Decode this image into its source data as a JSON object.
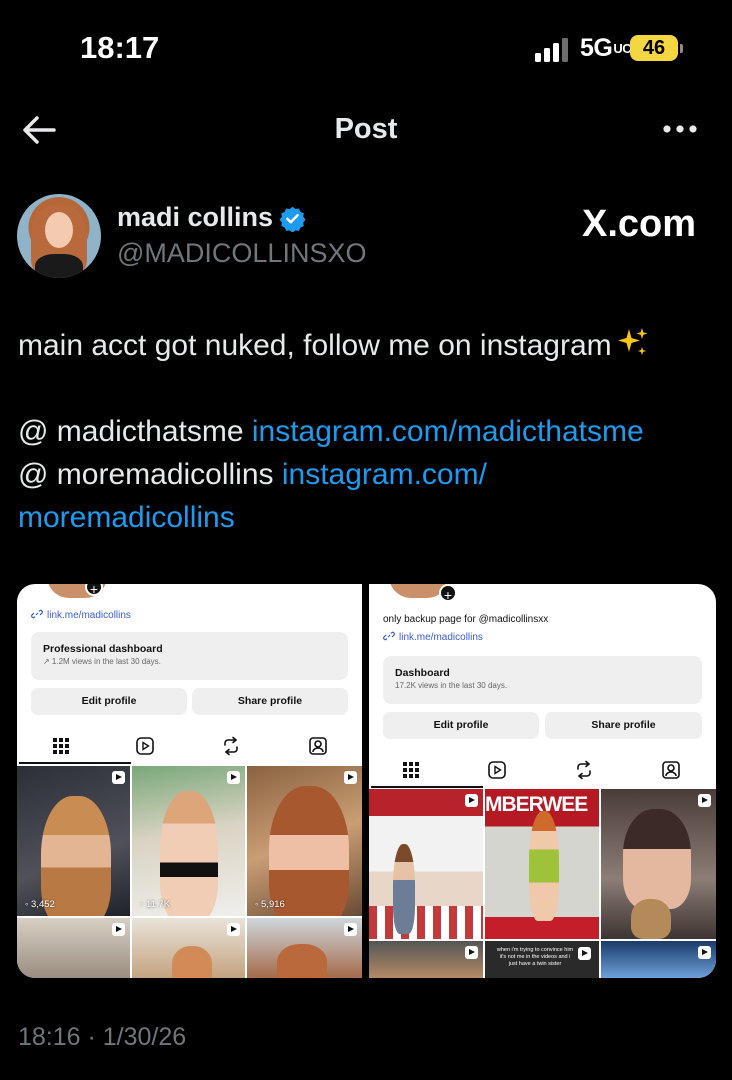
{
  "status_bar": {
    "time": "18:17",
    "network": "5G",
    "network_suffix": "UC",
    "battery": "46"
  },
  "nav": {
    "title": "Post",
    "back_icon": "arrow-left-icon",
    "more_icon": "more-horizontal-icon"
  },
  "author": {
    "display_name": "madi collins",
    "handle": "@MADICOLLINSXO",
    "verified": true,
    "verified_color": "#1d9bf0"
  },
  "watermark": "X.com",
  "post": {
    "line1": "main acct got nuked, follow me on instagram",
    "line2_prefix": "@ madicthatsme ",
    "line2_link": "instagram.com/madicthatsme",
    "line3_prefix": "@ moremadicollins ",
    "line3_link": "instagram.com/",
    "line4_link": "moremadicollins",
    "link_color": "#1d9bf0"
  },
  "media": {
    "left": {
      "link": "link.me/madicollins",
      "dashboard_title": "Professional dashboard",
      "dashboard_sub": "↗ 1.2M views in the last 30 days.",
      "edit_label": "Edit profile",
      "share_label": "Share profile",
      "views": [
        "3,452",
        "11.7K",
        "5,916"
      ]
    },
    "right": {
      "bio": "only backup page for @madicollinsxx",
      "link": "link.me/madicollins",
      "dashboard_title": "Dashboard",
      "dashboard_sub": "17.2K views in the last 30 days.",
      "edit_label": "Edit profile",
      "share_label": "Share profile",
      "sign_text": "MBERWEE",
      "caption": "when i'm trying to convince him it's not me in the videos and i just have a twin sister"
    }
  },
  "timestamp": "18:16 · 1/30/26"
}
